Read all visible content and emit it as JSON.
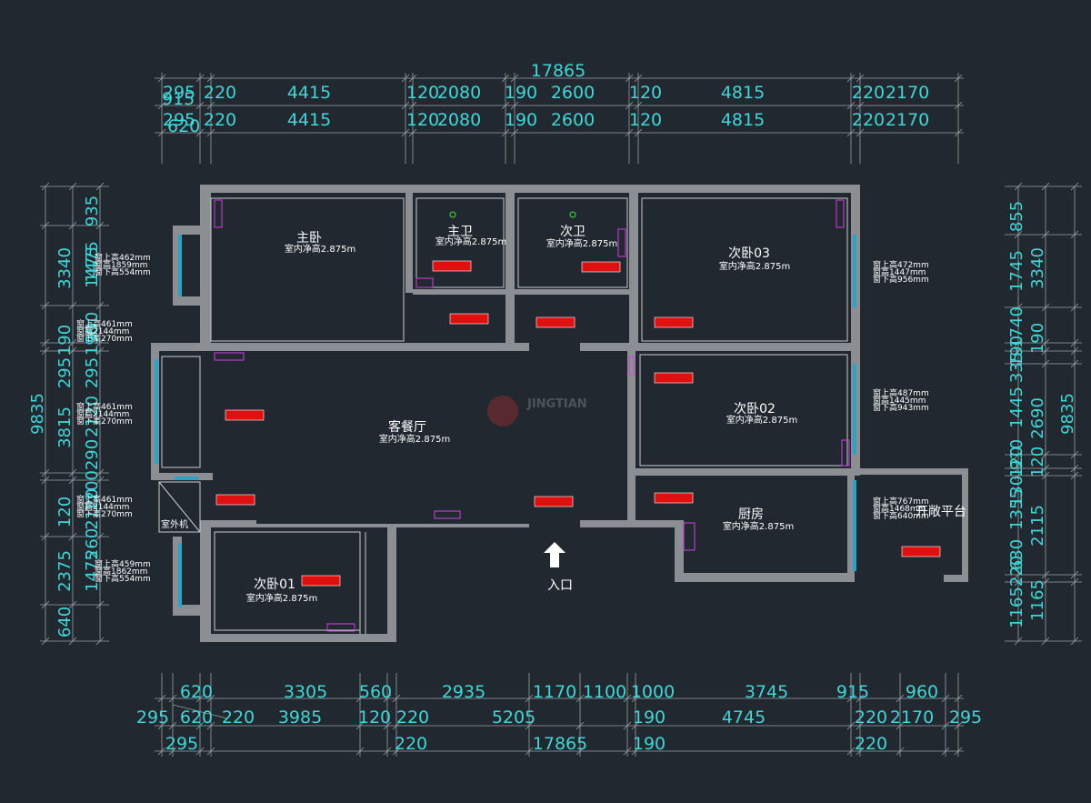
{
  "top_dims": {
    "total": "17865",
    "row1": [
      "295",
      "220",
      "4415",
      "120",
      "2080",
      "190",
      "2600",
      "120",
      "4815",
      "220",
      "2170"
    ],
    "row1_sub": "915",
    "row2": [
      "295",
      "220",
      "4415",
      "120",
      "2080",
      "190",
      "2600",
      "120",
      "4815",
      "220",
      "2170"
    ],
    "row2_sub": "620"
  },
  "bottom_dims": {
    "row1": [
      "620",
      "3305",
      "560",
      "2935",
      "1170",
      "1100",
      "1000",
      "3745",
      "915",
      "960"
    ],
    "row2": [
      "295",
      "620",
      "220",
      "3985",
      "120",
      "220",
      "5205",
      "190",
      "4745",
      "220",
      "2170",
      "295"
    ],
    "row3": [
      "295",
      "220",
      "17865",
      "190",
      "220"
    ]
  },
  "left_dims": {
    "total": "9835",
    "outer": [
      "3340",
      "190",
      "295",
      "3815",
      "120",
      "2375",
      "640"
    ],
    "inner": [
      "935",
      "1475",
      "1475",
      "190",
      "990",
      "295",
      "290",
      "2120",
      "1200",
      "2120",
      "260",
      "1475"
    ]
  },
  "right_dims": {
    "total": "9835",
    "outer": [
      "3340",
      "190",
      "2690",
      "120",
      "2115",
      "1165"
    ],
    "inner": [
      "855",
      "1745",
      "1740",
      "190",
      "335",
      "1445",
      "910",
      "120",
      "1355",
      "130",
      "630",
      "220",
      "1165"
    ]
  },
  "rooms": [
    {
      "name": "主卧",
      "height": "室内净高2.875m"
    },
    {
      "name": "主卫",
      "height": "室内净高2.875m"
    },
    {
      "name": "次卫",
      "height": "室内净高2.875m"
    },
    {
      "name": "次卧03",
      "height": "室内净高2.875m"
    },
    {
      "name": "客餐厅",
      "height": "室内净高2.875m"
    },
    {
      "name": "次卧02",
      "height": "室内净高2.875m"
    },
    {
      "name": "厨房",
      "height": "室内净高2.875m"
    },
    {
      "name": "次卧01",
      "height": "室内净高2.875m"
    },
    {
      "name": "开敞平台",
      "height": ""
    }
  ],
  "windows": [
    {
      "sill": "窗上高462mm",
      "h": "窗高1859mm",
      "low": "窗下高554mm"
    },
    {
      "sill": "窗上高461mm",
      "h": "窗高2144mm",
      "low": "窗下高270mm"
    },
    {
      "sill": "窗上高461mm",
      "h": "窗高2144mm",
      "low": "窗下高270mm"
    },
    {
      "sill": "窗上高461mm",
      "h": "窗高2144mm",
      "low": "窗下高270mm"
    },
    {
      "sill": "窗上高459mm",
      "h": "窗高1862mm",
      "low": "窗下高554mm"
    },
    {
      "sill": "窗上高472mm",
      "h": "窗高1447mm",
      "low": "窗下高956mm"
    },
    {
      "sill": "窗上高487mm",
      "h": "窗高1445mm",
      "low": "窗下高943mm"
    },
    {
      "sill": "窗上高767mm",
      "h": "窗高1468mm",
      "low": "窗下高640mm"
    }
  ],
  "labels": {
    "entrance": "入口",
    "outdoor_unit": "室外机",
    "watermark": "JINGTIAN"
  },
  "colors": {
    "background": "#212830",
    "dimension": "#3fd6d6",
    "heater": "#e01010",
    "wall": "#8b8f93"
  }
}
